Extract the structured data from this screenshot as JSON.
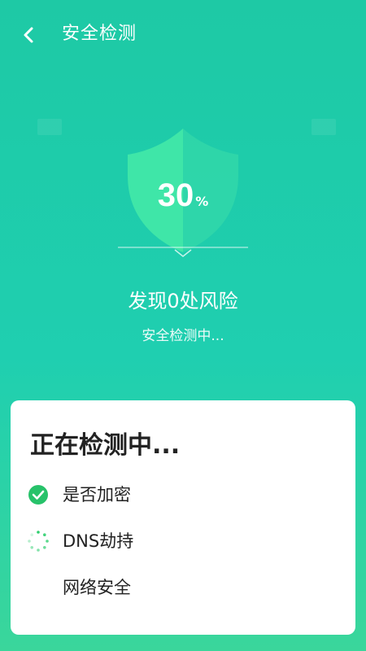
{
  "header": {
    "title": "安全检测",
    "back_icon": "chevron-left-icon"
  },
  "scan": {
    "progress_value": "30",
    "progress_unit": "%",
    "progress_fraction": 0.3,
    "risk_text": "发现0处风险",
    "status_text": "安全检测中..."
  },
  "card": {
    "title": "正在检测中...",
    "items": [
      {
        "label": "是否加密",
        "state": "done",
        "icon": "check-circle-icon"
      },
      {
        "label": "DNS劫持",
        "state": "in-progress",
        "icon": "loading-spinner-icon"
      },
      {
        "label": "网络安全",
        "state": "pending",
        "icon": ""
      }
    ]
  },
  "colors": {
    "background_top": "#1ec9a5",
    "background_bottom": "#3ad69b",
    "shield_light": "#3fe6a8",
    "check_green": "#27c26a"
  }
}
